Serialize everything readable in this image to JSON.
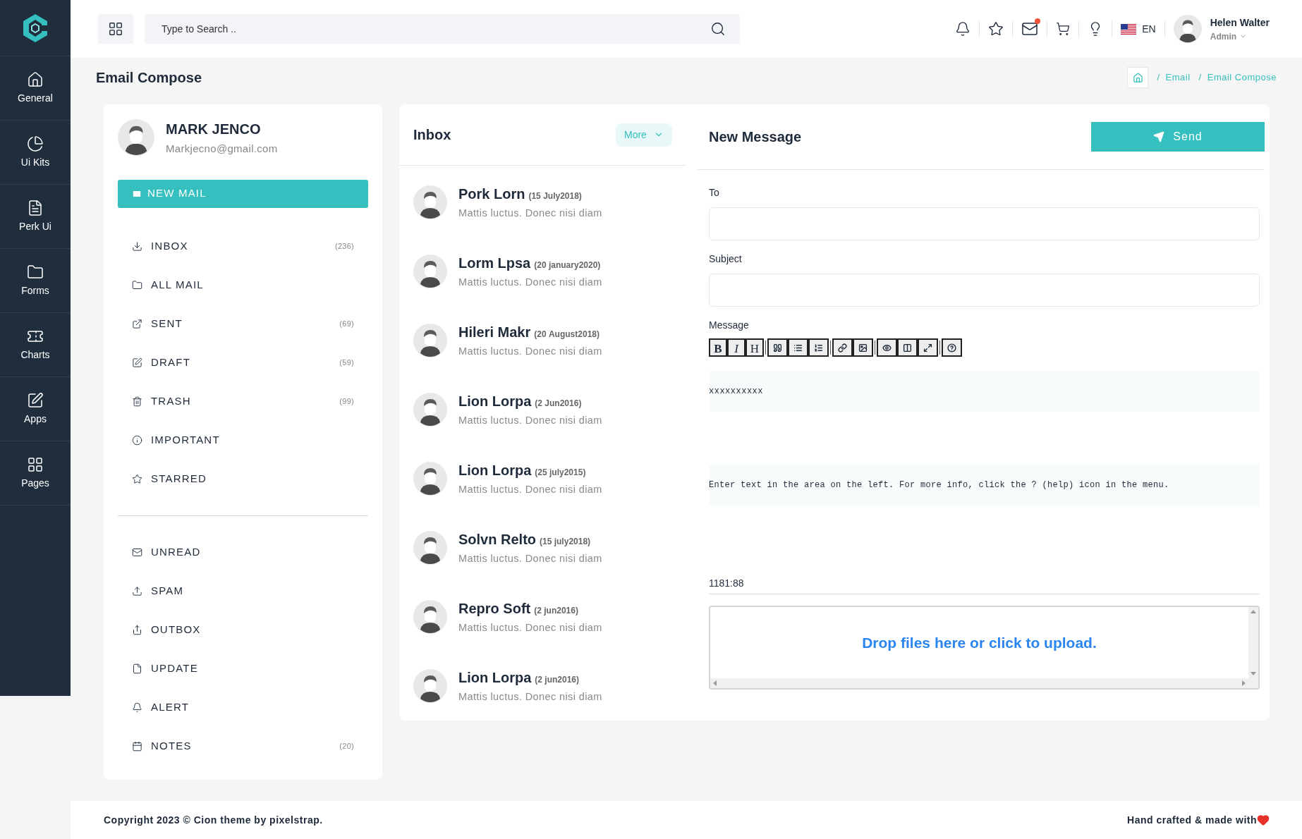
{
  "sidebar": {
    "items": [
      {
        "label": "General",
        "selected": false
      },
      {
        "label": "Ui Kits",
        "selected": false
      },
      {
        "label": "Perk Ui",
        "selected": false
      },
      {
        "label": "Forms",
        "selected": false
      },
      {
        "label": "Charts",
        "selected": false
      },
      {
        "label": "Apps",
        "selected": false
      },
      {
        "label": "Pages",
        "selected": false
      }
    ]
  },
  "header": {
    "search": {
      "placeholder": "Type to Search .."
    },
    "mail_unread": true,
    "language": "EN",
    "user": {
      "name": "Helen Walter",
      "role": "Admin"
    }
  },
  "page": {
    "title": "Email Compose",
    "breadcrumb": {
      "separator": "/",
      "items": [
        "Email",
        "Email Compose"
      ]
    }
  },
  "profile": {
    "name": "MARK JENCO",
    "email": "Markjecno@gmail.com",
    "new_mail": "NEW MAIL"
  },
  "folders": [
    {
      "label": "INBOX",
      "count": "(236)"
    },
    {
      "label": "ALL MAIL"
    },
    {
      "label": "SENT",
      "count": "(69)"
    },
    {
      "label": "DRAFT",
      "count": "(59)"
    },
    {
      "label": "TRASH",
      "count": "(99)"
    },
    {
      "label": "IMPORTANT"
    },
    {
      "label": "STARRED"
    }
  ],
  "labels": [
    {
      "label": "UNREAD"
    },
    {
      "label": "SPAM"
    },
    {
      "label": "OUTBOX"
    },
    {
      "label": "UPDATE"
    },
    {
      "label": "ALERT"
    },
    {
      "label": "NOTES",
      "count": "(20)"
    }
  ],
  "inbox": {
    "title": "Inbox",
    "more": "More",
    "mails": [
      {
        "sender": "Pork Lorn",
        "date": "(15 **July**2018)",
        "preview": "Mattis luctus. Donec nisi diam"
      },
      {
        "sender": "Lorm Lpsa",
        "date": "(20 **january**2020)",
        "preview": "Mattis luctus. Donec nisi diam"
      },
      {
        "sender": "Hileri Makr",
        "date": "(20 **August**2018)",
        "preview": "Mattis luctus. Donec nisi diam"
      },
      {
        "sender": "Lion Lorpa",
        "date": "(2 **Jun**2016)",
        "preview": "Mattis luctus. Donec nisi diam"
      },
      {
        "sender": "Lion Lorpa",
        "date": "(25 **july**2015)",
        "preview": "Mattis luctus. Donec nisi diam"
      },
      {
        "sender": "Solvn Relto",
        "date": "(15 **july**2018)",
        "preview": "Mattis luctus. Donec nisi diam"
      },
      {
        "sender": "Repro Soft",
        "date": "(2 **jun**2016)",
        "preview": "Mattis luctus. Donec nisi diam"
      },
      {
        "sender": "Lion Lorpa",
        "date": "(2 **jun**2016)",
        "preview": "Mattis luctus. Donec nisi diam"
      }
    ]
  },
  "compose": {
    "title": "New Message",
    "send": "Send",
    "to_label": "To",
    "subject_label": "Subject",
    "message_label": "Message",
    "toolbar_text": [
      "B",
      "I",
      "H"
    ],
    "editor_text": "xxxxxxxxxx",
    "preview_text": "Enter text in the area on the left. For more info, click the ? (help) icon in the menu.",
    "status": "1181:88",
    "dropzone": "Drop files here or click to upload."
  },
  "footer": {
    "copyright": "Copyright 2023 © Cion theme by pixelstrap.",
    "credit": "Hand crafted & made with"
  }
}
